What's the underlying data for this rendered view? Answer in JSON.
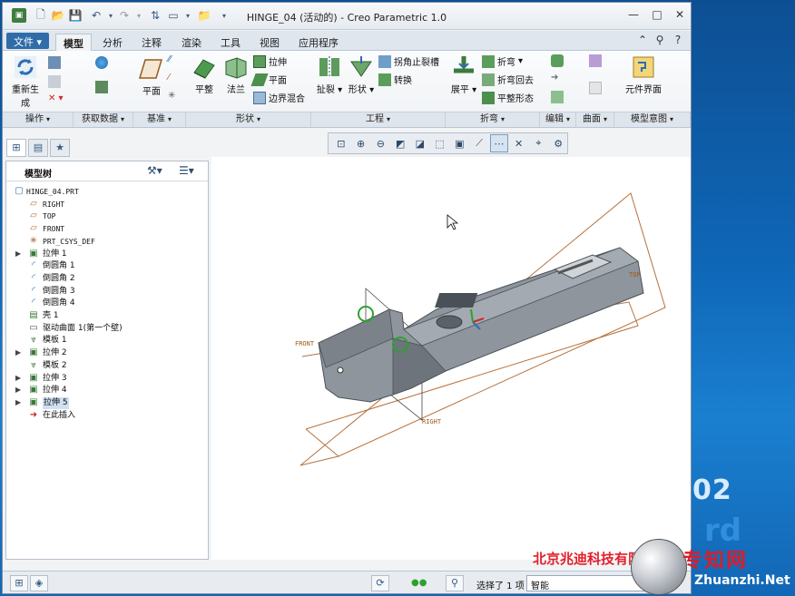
{
  "window": {
    "title": "HINGE_04 (活动的) - Creo Parametric 1.0"
  },
  "quick_access": {
    "icons": [
      "app-icon",
      "new-icon",
      "open-icon",
      "save-icon",
      "undo-icon",
      "redo-icon",
      "regenerate-icon",
      "window-icon",
      "folder-icon",
      "customize-icon"
    ]
  },
  "tabs": {
    "file": "文件",
    "items": [
      "模型",
      "分析",
      "注释",
      "渲染",
      "工具",
      "视图",
      "应用程序"
    ],
    "active": "模型"
  },
  "ribbon": {
    "regenerate": "重新生成",
    "plane": "平面",
    "flat": "平整",
    "flange": "法兰",
    "extrude": "拉伸",
    "flat_small": "平面",
    "boundary_blend": "边界混合",
    "rip": "扯裂",
    "form": "形状",
    "corner_relief": "拐角止裂槽",
    "convert": "转换",
    "unbend": "展平",
    "bend": "折弯",
    "bend_back": "折弯回去",
    "flat_pattern": "平整形态",
    "component_interface": "元件界面",
    "groups": {
      "operations": "操作",
      "get_data": "获取数据",
      "datum": "基准",
      "shapes": "形状",
      "engineering": "工程",
      "bends": "折弯",
      "editing": "编辑",
      "surfaces": "曲面",
      "model_intent": "模型意图"
    }
  },
  "model_tree": {
    "title": "模型树",
    "items": [
      {
        "label": "HINGE_04.PRT",
        "type": "part",
        "expand": false
      },
      {
        "label": "RIGHT",
        "type": "plane",
        "expand": false
      },
      {
        "label": "TOP",
        "type": "plane",
        "expand": false
      },
      {
        "label": "FRONT",
        "type": "plane",
        "expand": false
      },
      {
        "label": "PRT_CSYS_DEF",
        "type": "csys",
        "expand": false
      },
      {
        "label": "拉伸 1",
        "type": "extrude",
        "expand": true
      },
      {
        "label": "倒圆角 1",
        "type": "round",
        "expand": false
      },
      {
        "label": "倒圆角 2",
        "type": "round",
        "expand": false
      },
      {
        "label": "倒圆角 3",
        "type": "round",
        "expand": false
      },
      {
        "label": "倒圆角 4",
        "type": "round",
        "expand": false
      },
      {
        "label": "壳 1",
        "type": "shell",
        "expand": false
      },
      {
        "label": "驱动曲面 1(第一个壁)",
        "type": "surface",
        "expand": false
      },
      {
        "label": "模板 1",
        "type": "template",
        "expand": false
      },
      {
        "label": "拉伸 2",
        "type": "extrude",
        "expand": true
      },
      {
        "label": "模板 2",
        "type": "template",
        "expand": false
      },
      {
        "label": "拉伸 3",
        "type": "extrude",
        "expand": true
      },
      {
        "label": "拉伸 4",
        "type": "extrude",
        "expand": true
      },
      {
        "label": "拉伸 5",
        "type": "extrude",
        "expand": true,
        "selected": true
      },
      {
        "label": "在此插入",
        "type": "insert",
        "expand": false
      }
    ]
  },
  "viewport": {
    "datum_labels": [
      "FRONT",
      "RIGHT",
      "TOP"
    ]
  },
  "status": {
    "selection": "选择了 1 项",
    "filter": "智能"
  },
  "overlay": {
    "watermark_company": "北京兆迪科技有限公司",
    "watermark_site": "Zhuanzhi.Net",
    "watermark_cn": "专知网",
    "desktop_number": "02"
  }
}
